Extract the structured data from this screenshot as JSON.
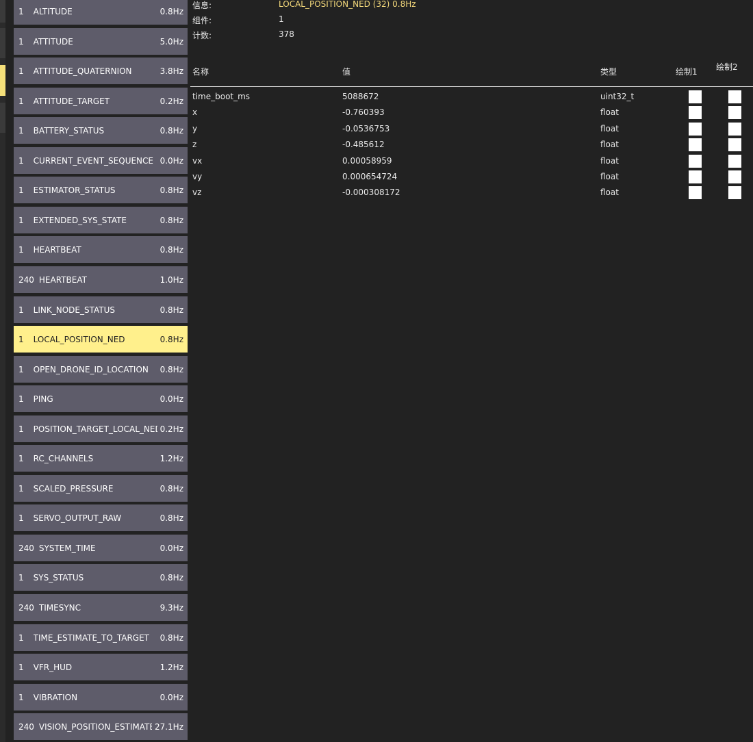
{
  "info": {
    "message_label": "信息:",
    "message_value": "LOCAL_POSITION_NED (32) 0.8Hz",
    "component_label": "组件:",
    "component_value": "1",
    "count_label": "计数:",
    "count_value": "378",
    "accent_color": "#f2d77a"
  },
  "table": {
    "headers": {
      "name": "名称",
      "value": "值",
      "type": "类型",
      "plot1": "绘制1",
      "plot2": "绘制2"
    },
    "rows": [
      {
        "name": "time_boot_ms",
        "value": "5088672",
        "type": "uint32_t"
      },
      {
        "name": "x",
        "value": "-0.760393",
        "type": "float"
      },
      {
        "name": "y",
        "value": "-0.0536753",
        "type": "float"
      },
      {
        "name": "z",
        "value": "-0.485612",
        "type": "float"
      },
      {
        "name": "vx",
        "value": "0.00058959",
        "type": "float"
      },
      {
        "name": "vy",
        "value": "0.000654724",
        "type": "float"
      },
      {
        "name": "vz",
        "value": "-0.000308172",
        "type": "float"
      }
    ]
  },
  "messages": [
    {
      "component": "1",
      "name": "ALTITUDE",
      "rate": "0.8Hz"
    },
    {
      "component": "1",
      "name": "ATTITUDE",
      "rate": "5.0Hz"
    },
    {
      "component": "1",
      "name": "ATTITUDE_QUATERNION",
      "rate": "3.8Hz"
    },
    {
      "component": "1",
      "name": "ATTITUDE_TARGET",
      "rate": "0.2Hz"
    },
    {
      "component": "1",
      "name": "BATTERY_STATUS",
      "rate": "0.8Hz"
    },
    {
      "component": "1",
      "name": "CURRENT_EVENT_SEQUENCE",
      "rate": "0.0Hz"
    },
    {
      "component": "1",
      "name": "ESTIMATOR_STATUS",
      "rate": "0.8Hz"
    },
    {
      "component": "1",
      "name": "EXTENDED_SYS_STATE",
      "rate": "0.8Hz"
    },
    {
      "component": "1",
      "name": "HEARTBEAT",
      "rate": "0.8Hz"
    },
    {
      "component": "240",
      "name": "HEARTBEAT",
      "rate": "1.0Hz"
    },
    {
      "component": "1",
      "name": "LINK_NODE_STATUS",
      "rate": "0.8Hz"
    },
    {
      "component": "1",
      "name": "LOCAL_POSITION_NED",
      "rate": "0.8Hz",
      "selected": true
    },
    {
      "component": "1",
      "name": "OPEN_DRONE_ID_LOCATION",
      "rate": "0.8Hz"
    },
    {
      "component": "1",
      "name": "PING",
      "rate": "0.0Hz"
    },
    {
      "component": "1",
      "name": "POSITION_TARGET_LOCAL_NED",
      "rate": "0.2Hz"
    },
    {
      "component": "1",
      "name": "RC_CHANNELS",
      "rate": "1.2Hz"
    },
    {
      "component": "1",
      "name": "SCALED_PRESSURE",
      "rate": "0.8Hz"
    },
    {
      "component": "1",
      "name": "SERVO_OUTPUT_RAW",
      "rate": "0.8Hz"
    },
    {
      "component": "240",
      "name": "SYSTEM_TIME",
      "rate": "0.0Hz"
    },
    {
      "component": "1",
      "name": "SYS_STATUS",
      "rate": "0.8Hz"
    },
    {
      "component": "240",
      "name": "TIMESYNC",
      "rate": "9.3Hz"
    },
    {
      "component": "1",
      "name": "TIME_ESTIMATE_TO_TARGET",
      "rate": "0.8Hz"
    },
    {
      "component": "1",
      "name": "VFR_HUD",
      "rate": "1.2Hz"
    },
    {
      "component": "1",
      "name": "VIBRATION",
      "rate": "0.0Hz"
    },
    {
      "component": "240",
      "name": "VISION_POSITION_ESTIMATE",
      "rate": "27.1Hz"
    }
  ],
  "colors": {
    "background": "#222222",
    "list_item": "#5e5c6a",
    "list_item_selected": "#fff08c",
    "checkbox": "#ffffff"
  }
}
